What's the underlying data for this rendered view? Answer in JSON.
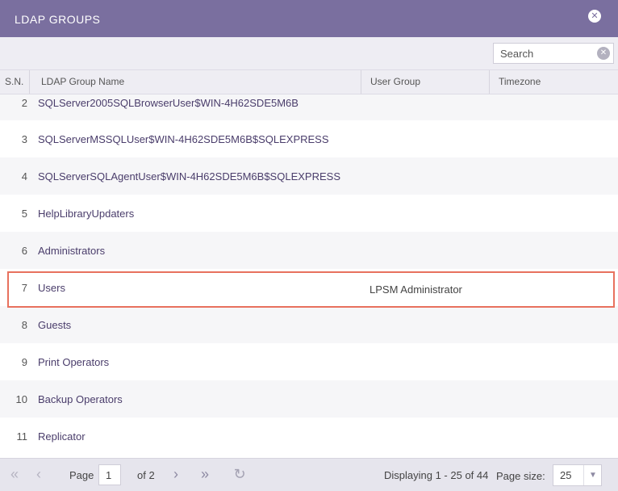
{
  "dialog": {
    "title": "LDAP GROUPS"
  },
  "search": {
    "placeholder": "Search"
  },
  "columns": {
    "sn": "S.N.",
    "name": "LDAP Group Name",
    "user_group": "User Group",
    "timezone": "Timezone"
  },
  "rows": [
    {
      "sn": "2",
      "name": "SQLServer2005SQLBrowserUser$WIN-4H62SDE5M6B",
      "user_group": "",
      "timezone": ""
    },
    {
      "sn": "3",
      "name": "SQLServerMSSQLUser$WIN-4H62SDE5M6B$SQLEXPRESS",
      "user_group": "",
      "timezone": ""
    },
    {
      "sn": "4",
      "name": "SQLServerSQLAgentUser$WIN-4H62SDE5M6B$SQLEXPRESS",
      "user_group": "",
      "timezone": ""
    },
    {
      "sn": "5",
      "name": "HelpLibraryUpdaters",
      "user_group": "",
      "timezone": ""
    },
    {
      "sn": "6",
      "name": "Administrators",
      "user_group": "",
      "timezone": ""
    },
    {
      "sn": "7",
      "name": "Users",
      "user_group": "LPSM Administrator",
      "timezone": ""
    },
    {
      "sn": "8",
      "name": "Guests",
      "user_group": "",
      "timezone": ""
    },
    {
      "sn": "9",
      "name": "Print Operators",
      "user_group": "",
      "timezone": ""
    },
    {
      "sn": "10",
      "name": "Backup Operators",
      "user_group": "",
      "timezone": ""
    },
    {
      "sn": "11",
      "name": "Replicator",
      "user_group": "",
      "timezone": ""
    }
  ],
  "pager": {
    "page_label": "Page",
    "current_page": "1",
    "of_pages": "of 2",
    "displaying": "Displaying 1 - 25 of 44",
    "page_size_label": "Page size:",
    "page_size": "25"
  },
  "icons": {
    "close": "close-icon",
    "search_clear": "clear-icon",
    "first": "first-page-icon",
    "prev": "prev-page-icon",
    "next": "next-page-icon",
    "last": "last-page-icon",
    "refresh": "refresh-icon",
    "dropdown": "chevron-down-icon"
  },
  "colors": {
    "header": "#7a6f9f",
    "highlight": "#e8715e",
    "link_text": "#4a3d6b"
  }
}
